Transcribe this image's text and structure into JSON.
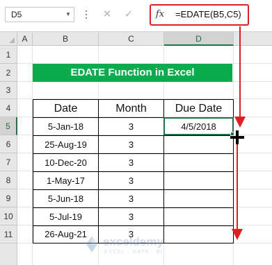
{
  "name_box": "D5",
  "formula": "=EDATE(B5,C5)",
  "fx_label": "fx",
  "columns": [
    "A",
    "B",
    "C",
    "D"
  ],
  "rows": [
    "1",
    "2",
    "3",
    "4",
    "5",
    "6",
    "7",
    "8",
    "9",
    "10",
    "11"
  ],
  "title": "EDATE Function in Excel",
  "table": {
    "headers": [
      "Date",
      "Month",
      "Due Date"
    ],
    "rows": [
      {
        "date": "5-Jan-18",
        "month": "3",
        "due": "4/5/2018"
      },
      {
        "date": "25-Aug-19",
        "month": "3",
        "due": ""
      },
      {
        "date": "10-Dec-20",
        "month": "3",
        "due": ""
      },
      {
        "date": "1-May-17",
        "month": "3",
        "due": ""
      },
      {
        "date": "5-Jun-18",
        "month": "3",
        "due": ""
      },
      {
        "date": "5-Jul-19",
        "month": "3",
        "due": ""
      },
      {
        "date": "26-Aug-21",
        "month": "3",
        "due": ""
      }
    ]
  },
  "watermark": {
    "name": "exceldemy",
    "tagline": "EXCEL · DATA · BI"
  },
  "colors": {
    "accent": "#0aab4d",
    "excel_green": "#217346",
    "annotation_red": "#e02020"
  }
}
